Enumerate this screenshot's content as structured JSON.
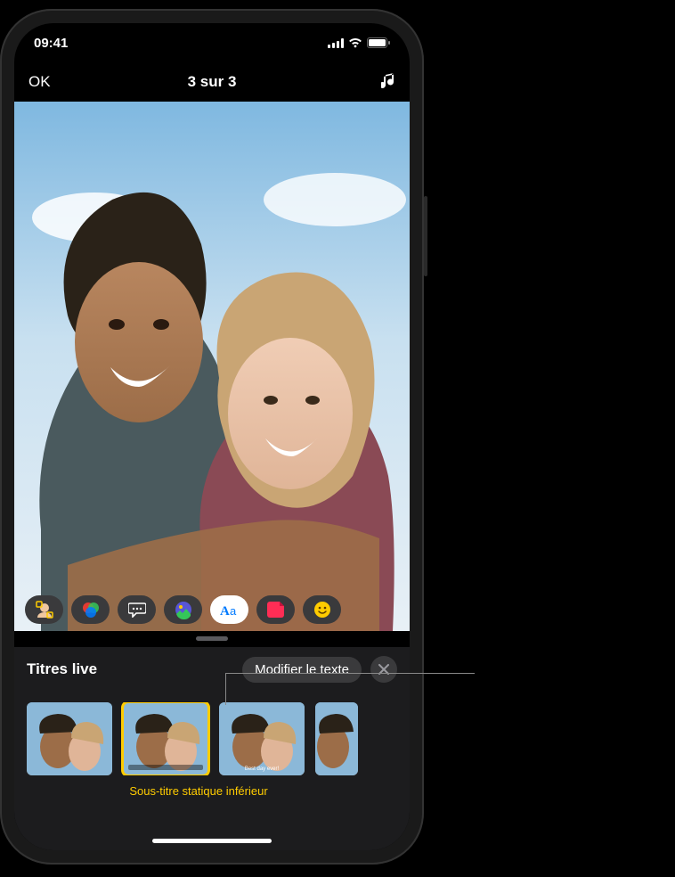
{
  "status_bar": {
    "time": "09:41"
  },
  "nav": {
    "ok_label": "OK",
    "title": "3 sur 3"
  },
  "tools": [
    {
      "name": "memoji-button"
    },
    {
      "name": "filters-button"
    },
    {
      "name": "speech-bubble-button"
    },
    {
      "name": "photos-button"
    },
    {
      "name": "text-style-button",
      "active": true
    },
    {
      "name": "stickers-button"
    },
    {
      "name": "emoji-button"
    }
  ],
  "panel": {
    "title": "Titres live",
    "edit_label": "Modifier le texte",
    "selected_label": "Sous-titre statique inférieur"
  },
  "thumbnails": [
    {
      "style": "none",
      "selected": false
    },
    {
      "style": "lower-caption",
      "selected": true
    },
    {
      "style": "lower-text",
      "selected": false
    },
    {
      "style": "overlay",
      "selected": false
    }
  ]
}
